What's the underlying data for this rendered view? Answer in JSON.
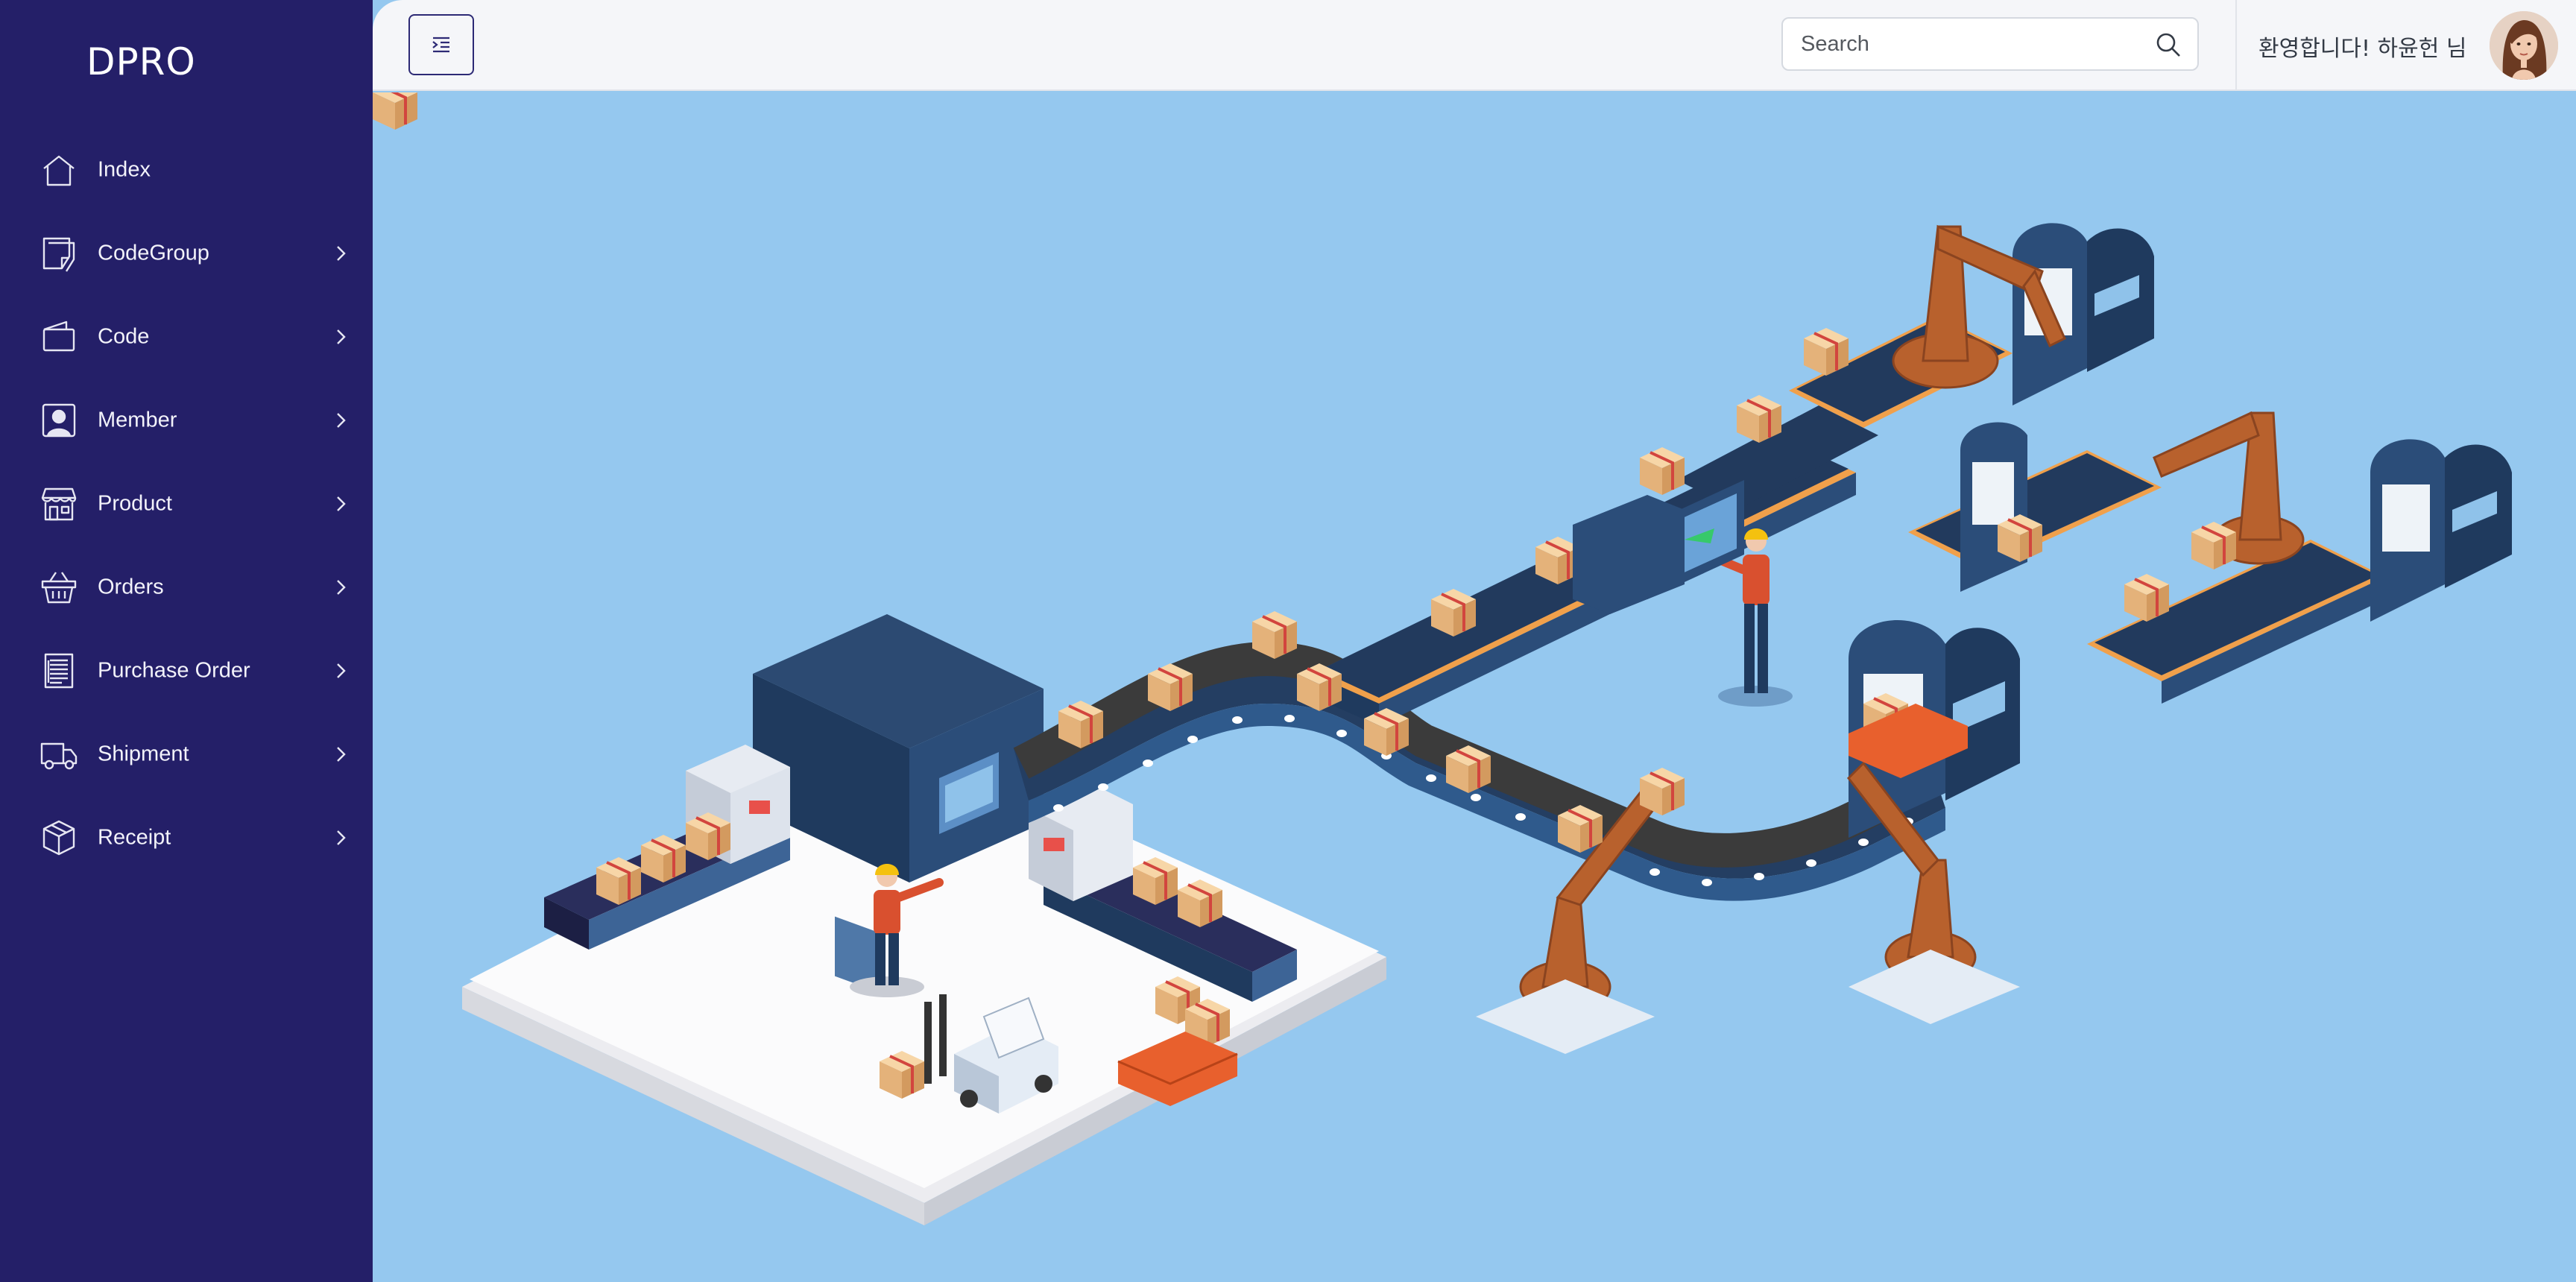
{
  "brand": {
    "name": "DPRO"
  },
  "sidebar": {
    "items": [
      {
        "label": "Index",
        "icon": "home-icon",
        "has_submenu": false
      },
      {
        "label": "CodeGroup",
        "icon": "sticky-note-icon",
        "has_submenu": true
      },
      {
        "label": "Code",
        "icon": "wallet-icon",
        "has_submenu": true
      },
      {
        "label": "Member",
        "icon": "user-icon",
        "has_submenu": true
      },
      {
        "label": "Product",
        "icon": "store-icon",
        "has_submenu": true
      },
      {
        "label": "Orders",
        "icon": "basket-icon",
        "has_submenu": true
      },
      {
        "label": "Purchase Order",
        "icon": "receipt-icon",
        "has_submenu": true
      },
      {
        "label": "Shipment",
        "icon": "truck-icon",
        "has_submenu": true
      },
      {
        "label": "Receipt",
        "icon": "box-icon",
        "has_submenu": true
      }
    ]
  },
  "header": {
    "menu_toggle_icon": "indent-icon",
    "search": {
      "placeholder": "Search",
      "value": "",
      "icon": "search-icon"
    },
    "welcome_text": "환영합니다!  하윤헌  님",
    "avatar_icon": "user-avatar"
  },
  "main": {
    "illustration": "isometric-factory-conveyor-illustration"
  },
  "colors": {
    "sidebar_bg": "#241f68",
    "header_bg": "#f5f6f9",
    "main_bg": "#95c8ef",
    "accent": "#2d2a75"
  }
}
